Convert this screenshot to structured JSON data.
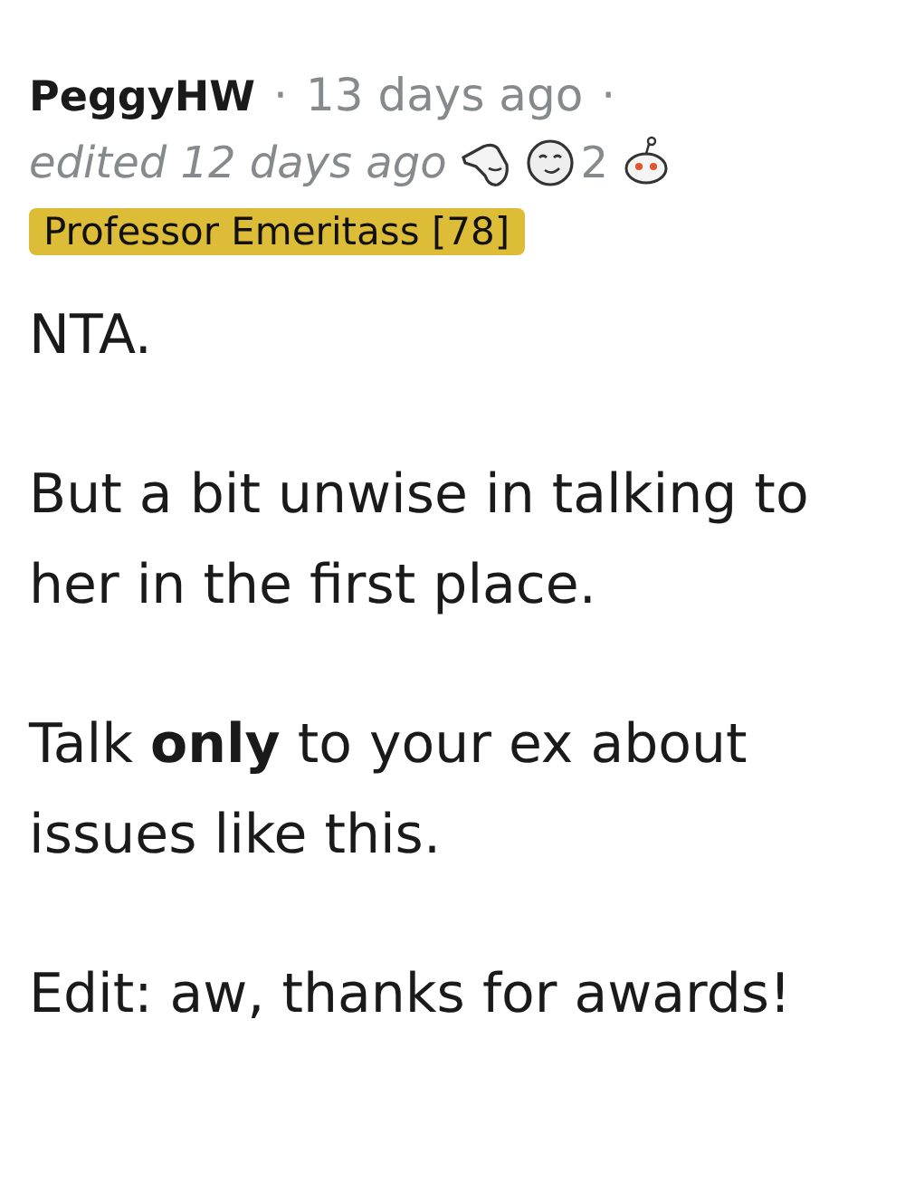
{
  "comment": {
    "author": "PeggyHW",
    "separator": "·",
    "time": "13 days ago",
    "separator_end": "·",
    "edited": "edited 12 days ago",
    "awards": [
      {
        "kind": "hand"
      },
      {
        "kind": "face",
        "count": "2"
      },
      {
        "kind": "alien"
      }
    ],
    "flair": "Professor Emeritass [78]",
    "paragraphs": [
      "NTA.",
      "But a bit unwise in talking to her in the first place.",
      "Talk **only** to your ex about issues like this.",
      "Edit: aw, thanks for awards!"
    ]
  }
}
